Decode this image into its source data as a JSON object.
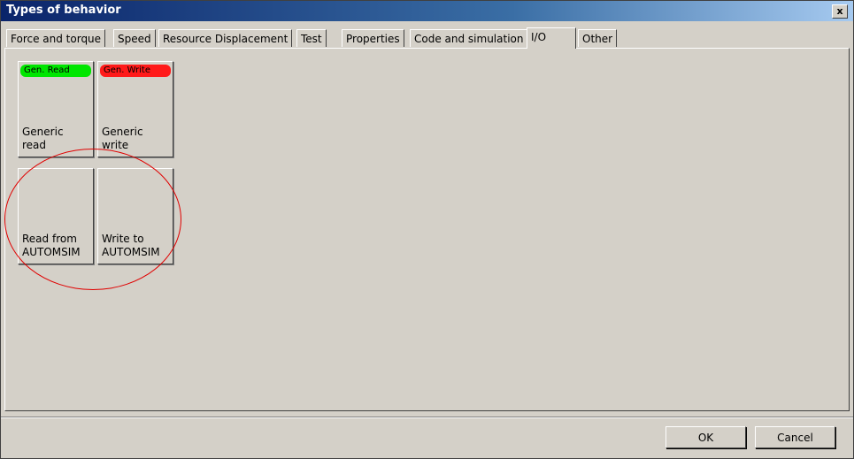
{
  "window": {
    "title": "Types of behavior",
    "close_label": "x"
  },
  "tabs": [
    {
      "label": "Force and torque"
    },
    {
      "label": "Speed"
    },
    {
      "label": "Resource Displacement"
    },
    {
      "label": "Test"
    },
    {
      "label": "Properties"
    },
    {
      "label": "Code and simulation"
    },
    {
      "label": "I/O",
      "active": true
    },
    {
      "label": "Other"
    }
  ],
  "tiles": [
    {
      "pill": "Gen. Read",
      "pill_color": "#00e600",
      "label_line1": "Generic",
      "label_line2": "read"
    },
    {
      "pill": "Gen. Write",
      "pill_color": "#ff1a1a",
      "label_line1": "Generic",
      "label_line2": "write"
    },
    {
      "label_line1": "Read from",
      "label_line2": "AUTOMSIM"
    },
    {
      "label_line1": "Write to",
      "label_line2": "AUTOMSIM"
    }
  ],
  "buttons": {
    "ok": "OK",
    "cancel": "Cancel"
  },
  "annotation": {
    "color": "#e00000"
  }
}
